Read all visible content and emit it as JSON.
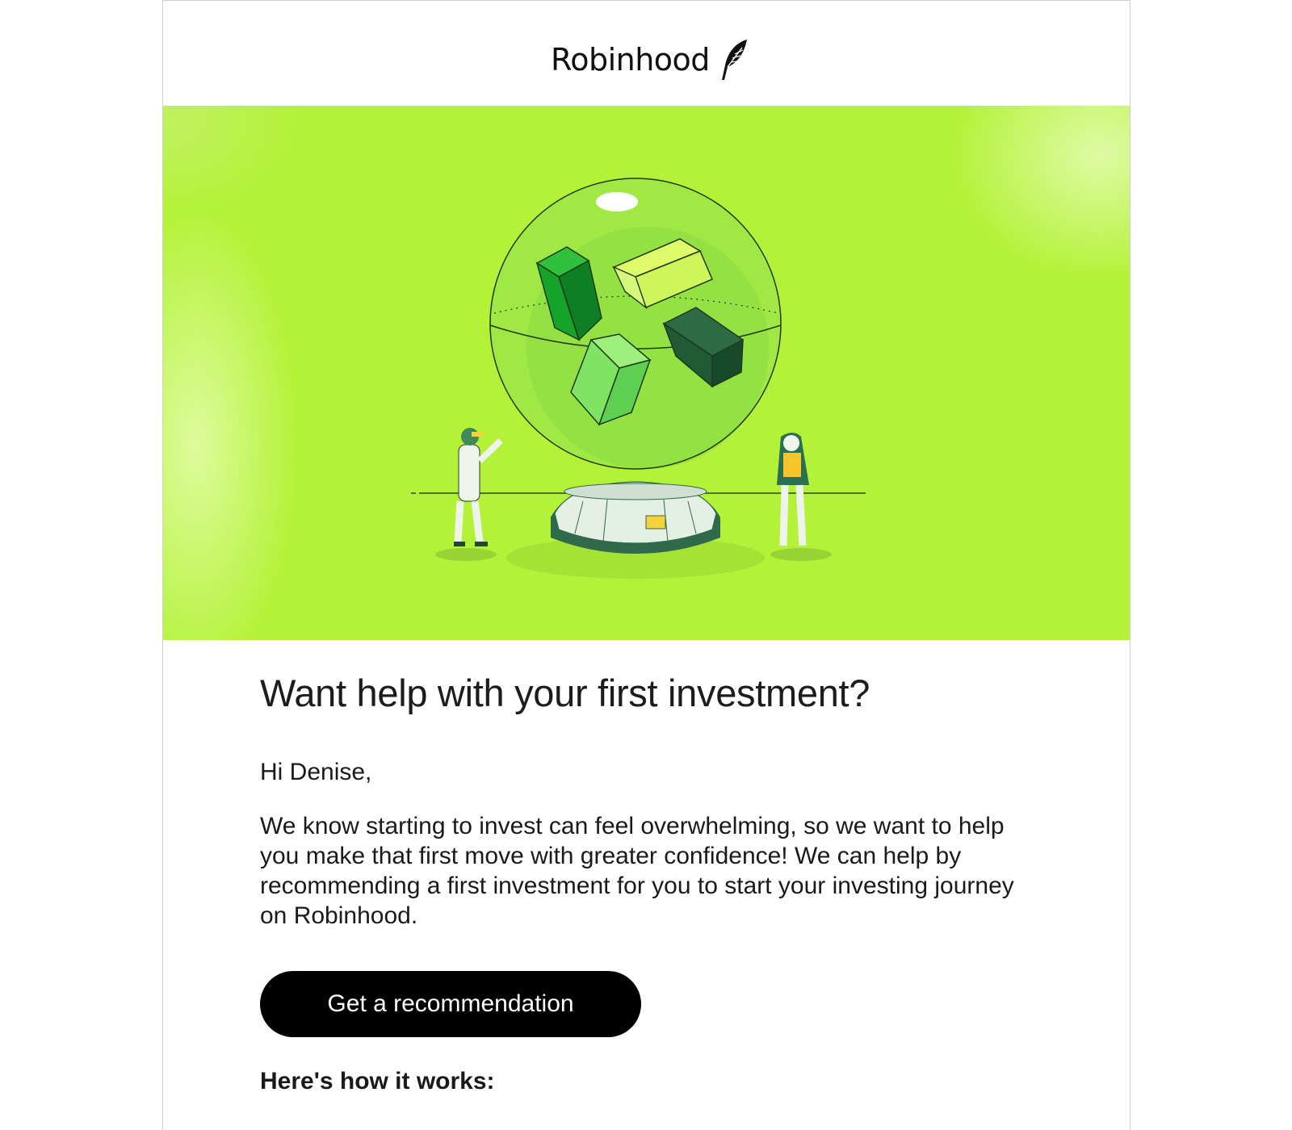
{
  "brand": {
    "name": "Robinhood",
    "logo_icon": "feather-icon"
  },
  "hero": {
    "alt": "illustration",
    "background_color": "#b4f23a"
  },
  "email": {
    "title": "Want help with your first investment?",
    "greeting": "Hi Denise,",
    "body": "We know starting to invest can feel overwhelming, so we want to help you make that first move with greater confidence! We can help by recommending a first investment for you to start your investing journey on Robinhood.",
    "cta_label": "Get a recommendation",
    "subheading": "Here's how it works:"
  },
  "colors": {
    "cta_background": "#000000",
    "cta_text": "#ffffff",
    "text": "#1a1a1a"
  }
}
